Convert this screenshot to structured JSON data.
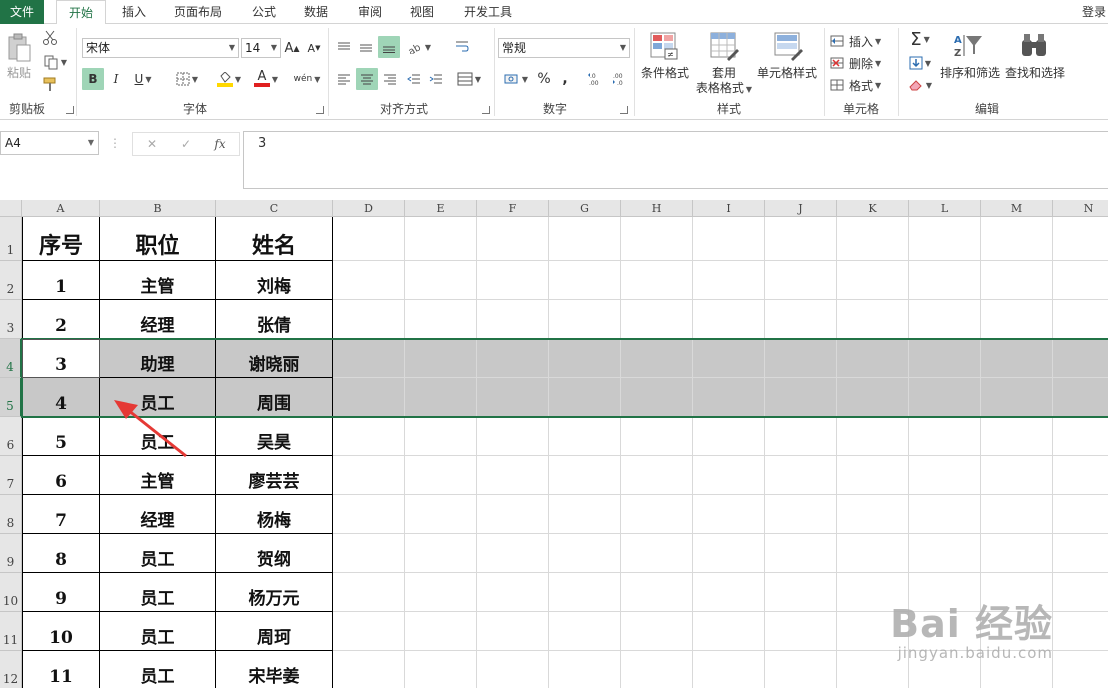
{
  "ribbon_tabs": {
    "file": "文件",
    "home": "开始",
    "insert": "插入",
    "page_layout": "页面布局",
    "formulas": "公式",
    "data": "数据",
    "review": "审阅",
    "view": "视图",
    "developer": "开发工具"
  },
  "login_label": "登录",
  "clipboard": {
    "paste_label": "粘贴",
    "group_label": "剪贴板"
  },
  "font": {
    "name": "宋体",
    "size": "14",
    "grow_label": "A",
    "shrink_label": "A",
    "bold_label": "B",
    "italic_label": "I",
    "underline_label": "U",
    "font_color_label": "A",
    "phonetic_label": "wén",
    "group_label": "字体"
  },
  "alignment": {
    "group_label": "对齐方式"
  },
  "number": {
    "format": "常规",
    "percent_label": "%",
    "comma_label": ",",
    "group_label": "数字"
  },
  "styles": {
    "conditional_format": "条件格式",
    "table_format_line1": "套用",
    "table_format_line2": "表格格式",
    "cell_styles": "单元格样式",
    "group_label": "样式"
  },
  "cells": {
    "insert": "插入",
    "delete": "删除",
    "format": "格式",
    "group_label": "单元格"
  },
  "editing": {
    "sort_filter": "排序和筛选",
    "find_select": "查找和选择",
    "group_label": "编辑"
  },
  "formula_bar": {
    "name_box": "A4",
    "cancel_label": "✕",
    "enter_label": "✓",
    "fx_label": "fx",
    "value": "3"
  },
  "columns": [
    "A",
    "B",
    "C",
    "D",
    "E",
    "F",
    "G",
    "H",
    "I",
    "J",
    "K",
    "L",
    "M",
    "N"
  ],
  "rows": [
    "1",
    "2",
    "3",
    "4",
    "5",
    "6",
    "7",
    "8",
    "9",
    "10",
    "11",
    "12"
  ],
  "table": {
    "header": [
      "序号",
      "职位",
      "姓名"
    ],
    "rows": [
      [
        "1",
        "主管",
        "刘梅"
      ],
      [
        "2",
        "经理",
        "张倩"
      ],
      [
        "3",
        "助理",
        "谢晓丽"
      ],
      [
        "4",
        "员工",
        "周围"
      ],
      [
        "5",
        "员工",
        "吴昊"
      ],
      [
        "6",
        "主管",
        "廖芸芸"
      ],
      [
        "7",
        "经理",
        "杨梅"
      ],
      [
        "8",
        "员工",
        "贺纲"
      ],
      [
        "9",
        "员工",
        "杨万元"
      ],
      [
        "10",
        "员工",
        "周珂"
      ],
      [
        "11",
        "员工",
        "宋毕姜"
      ]
    ]
  },
  "watermark": {
    "main": "Bai 经验",
    "sub": "jingyan.baidu.com"
  },
  "colors": {
    "accent": "#217346",
    "selection_fill": "#c8c8c8",
    "pressed_button": "#9fd5b7",
    "arrow": "#e53935"
  }
}
